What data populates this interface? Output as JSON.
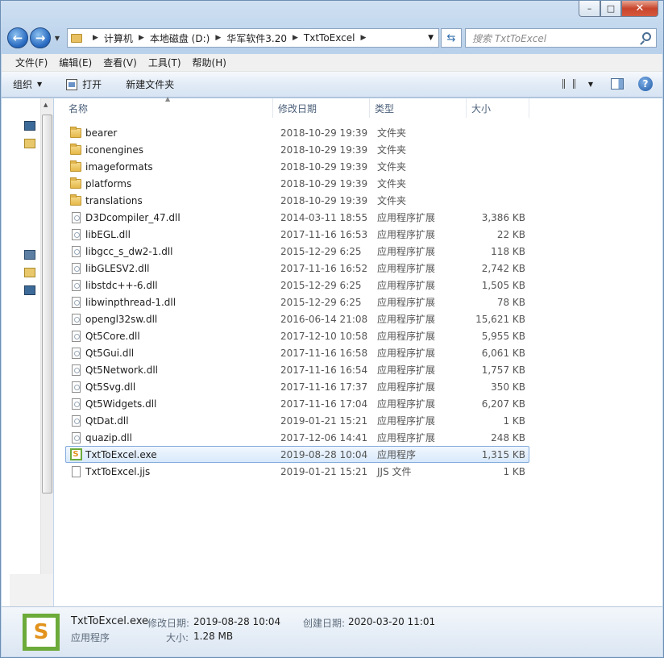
{
  "window": {
    "min_glyph": "–",
    "max_glyph": "□",
    "close_glyph": "✕"
  },
  "address": {
    "crumbs": [
      "计算机",
      "本地磁盘 (D:)",
      "华军软件3.20",
      "TxtToExcel"
    ],
    "search_placeholder": "搜索 TxtToExcel"
  },
  "menu": [
    "文件(F)",
    "编辑(E)",
    "查看(V)",
    "工具(T)",
    "帮助(H)"
  ],
  "toolbar": {
    "organize": "组织",
    "open": "打开",
    "new_folder": "新建文件夹"
  },
  "columns": {
    "name": "名称",
    "date": "修改日期",
    "type": "类型",
    "size": "大小"
  },
  "files": [
    {
      "name": "bearer",
      "date": "2018-10-29 19:39",
      "type": "文件夹",
      "size": "",
      "kind": "folder"
    },
    {
      "name": "iconengines",
      "date": "2018-10-29 19:39",
      "type": "文件夹",
      "size": "",
      "kind": "folder"
    },
    {
      "name": "imageformats",
      "date": "2018-10-29 19:39",
      "type": "文件夹",
      "size": "",
      "kind": "folder"
    },
    {
      "name": "platforms",
      "date": "2018-10-29 19:39",
      "type": "文件夹",
      "size": "",
      "kind": "folder"
    },
    {
      "name": "translations",
      "date": "2018-10-29 19:39",
      "type": "文件夹",
      "size": "",
      "kind": "folder"
    },
    {
      "name": "D3Dcompiler_47.dll",
      "date": "2014-03-11 18:55",
      "type": "应用程序扩展",
      "size": "3,386 KB",
      "kind": "dll"
    },
    {
      "name": "libEGL.dll",
      "date": "2017-11-16 16:53",
      "type": "应用程序扩展",
      "size": "22 KB",
      "kind": "dll"
    },
    {
      "name": "libgcc_s_dw2-1.dll",
      "date": "2015-12-29 6:25",
      "type": "应用程序扩展",
      "size": "118 KB",
      "kind": "dll"
    },
    {
      "name": "libGLESV2.dll",
      "date": "2017-11-16 16:52",
      "type": "应用程序扩展",
      "size": "2,742 KB",
      "kind": "dll"
    },
    {
      "name": "libstdc++-6.dll",
      "date": "2015-12-29 6:25",
      "type": "应用程序扩展",
      "size": "1,505 KB",
      "kind": "dll"
    },
    {
      "name": "libwinpthread-1.dll",
      "date": "2015-12-29 6:25",
      "type": "应用程序扩展",
      "size": "78 KB",
      "kind": "dll"
    },
    {
      "name": "opengl32sw.dll",
      "date": "2016-06-14 21:08",
      "type": "应用程序扩展",
      "size": "15,621 KB",
      "kind": "dll"
    },
    {
      "name": "Qt5Core.dll",
      "date": "2017-12-10 10:58",
      "type": "应用程序扩展",
      "size": "5,955 KB",
      "kind": "dll"
    },
    {
      "name": "Qt5Gui.dll",
      "date": "2017-11-16 16:58",
      "type": "应用程序扩展",
      "size": "6,061 KB",
      "kind": "dll"
    },
    {
      "name": "Qt5Network.dll",
      "date": "2017-11-16 16:54",
      "type": "应用程序扩展",
      "size": "1,757 KB",
      "kind": "dll"
    },
    {
      "name": "Qt5Svg.dll",
      "date": "2017-11-16 17:37",
      "type": "应用程序扩展",
      "size": "350 KB",
      "kind": "dll"
    },
    {
      "name": "Qt5Widgets.dll",
      "date": "2017-11-16 17:04",
      "type": "应用程序扩展",
      "size": "6,207 KB",
      "kind": "dll"
    },
    {
      "name": "QtDat.dll",
      "date": "2019-01-21 15:21",
      "type": "应用程序扩展",
      "size": "1 KB",
      "kind": "dll"
    },
    {
      "name": "quazip.dll",
      "date": "2017-12-06 14:41",
      "type": "应用程序扩展",
      "size": "248 KB",
      "kind": "dll"
    },
    {
      "name": "TxtToExcel.exe",
      "date": "2019-08-28 10:04",
      "type": "应用程序",
      "size": "1,315 KB",
      "kind": "exe",
      "selected": true
    },
    {
      "name": "TxtToExcel.jjs",
      "date": "2019-01-21 15:21",
      "type": "JJS 文件",
      "size": "1 KB",
      "kind": "file"
    }
  ],
  "details": {
    "name": "TxtToExcel.exe",
    "type": "应用程序",
    "modified_label": "修改日期:",
    "modified": "2019-08-28 10:04",
    "created_label": "创建日期:",
    "created": "2020-03-20 11:01",
    "size_label": "大小:",
    "size": "1.28 MB",
    "icon_glyph": "S"
  },
  "colors": {
    "selection_border": "#84acdd",
    "icon_green": "#6caa3a",
    "icon_orange": "#e2931d"
  }
}
